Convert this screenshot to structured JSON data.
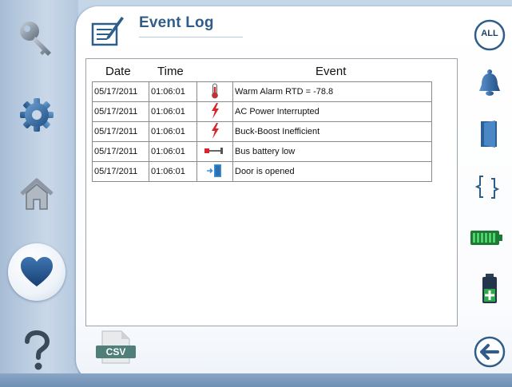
{
  "header": {
    "title": "Event Log"
  },
  "table": {
    "columns": [
      "Date",
      "Time",
      "Event"
    ],
    "rows": [
      {
        "date": "05/17/2011",
        "time": "01:06:01",
        "icon": "thermometer-icon",
        "event": "Warm Alarm RTD = -78.8"
      },
      {
        "date": "05/17/2011",
        "time": "01:06:01",
        "icon": "lightning-icon",
        "event": "AC Power Interrupted"
      },
      {
        "date": "05/17/2011",
        "time": "01:06:01",
        "icon": "lightning-icon",
        "event": "Buck-Boost Inefficient"
      },
      {
        "date": "05/17/2011",
        "time": "01:06:01",
        "icon": "battery-plug-icon",
        "event": "Bus battery low"
      },
      {
        "date": "05/17/2011",
        "time": "01:06:01",
        "icon": "door-arrow-icon",
        "event": "Door is opened"
      }
    ]
  },
  "csv": {
    "label": "CSV"
  },
  "filters": {
    "all_label": "ALL"
  },
  "colors": {
    "accent": "#2e5d8a",
    "alarm": "#d8262a",
    "battery": "#2fa84a"
  }
}
